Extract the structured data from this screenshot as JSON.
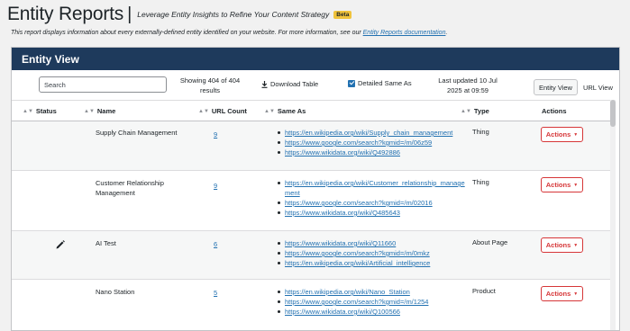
{
  "header": {
    "title": "Entity Reports",
    "separator": "|",
    "tagline": "Leverage Entity Insights to Refine Your Content Strategy",
    "badge": "Beta"
  },
  "intro": {
    "text": "This report displays information about every externally-defined entity identified on your website. For more information, see our ",
    "link": "Entity Reports documentation",
    "end": "."
  },
  "panel": {
    "title": "Entity View"
  },
  "toolbar": {
    "search_placeholder": "Search",
    "showing": "Showing 404 of 404 results",
    "download": "Download Table",
    "detailed_label": "Detailed Same As",
    "detailed_checked": true,
    "updated": "Last updated 10 Jul 2025 at 09:59",
    "view_entity": "Entity View",
    "view_url": "URL View"
  },
  "table": {
    "columns": [
      "Status",
      "Name",
      "URL Count",
      "Same As",
      "Type",
      "Actions"
    ],
    "rows": [
      {
        "status": "",
        "name": "Supply Chain Management",
        "url_count": "9",
        "same_as": [
          "https://en.wikipedia.org/wiki/Supply_chain_management",
          "https://www.google.com/search?kgmid=/m/06z59",
          "https://www.wikidata.org/wiki/Q492886"
        ],
        "type": "Thing",
        "action": "Actions"
      },
      {
        "status": "",
        "name": "Customer Relationship Management",
        "url_count": "9",
        "same_as": [
          "https://en.wikipedia.org/wiki/Customer_relationship_management",
          "https://www.google.com/search?kgmid=/m/02016",
          "https://www.wikidata.org/wiki/Q485643"
        ],
        "type": "Thing",
        "action": "Actions"
      },
      {
        "status": "pencil-icon",
        "name": "AI Test",
        "url_count": "6",
        "same_as": [
          "https://www.wikidata.org/wiki/Q11660",
          "https://www.google.com/search?kgmid=/m/0mkz",
          "https://en.wikipedia.org/wiki/Artificial_intelligence"
        ],
        "type": "About Page",
        "action": "Actions"
      },
      {
        "status": "",
        "name": "Nano Station",
        "url_count": "5",
        "same_as": [
          "https://en.wikipedia.org/wiki/Nano_Station",
          "https://www.google.com/search?kgmid=/m/1254",
          "https://www.wikidata.org/wiki/Q100566"
        ],
        "type": "Product",
        "action": "Actions"
      }
    ]
  },
  "colors": {
    "panel_header": "#1e3a5c",
    "link": "#2271b1",
    "action": "#d63638",
    "badge": "#f0c33c"
  }
}
